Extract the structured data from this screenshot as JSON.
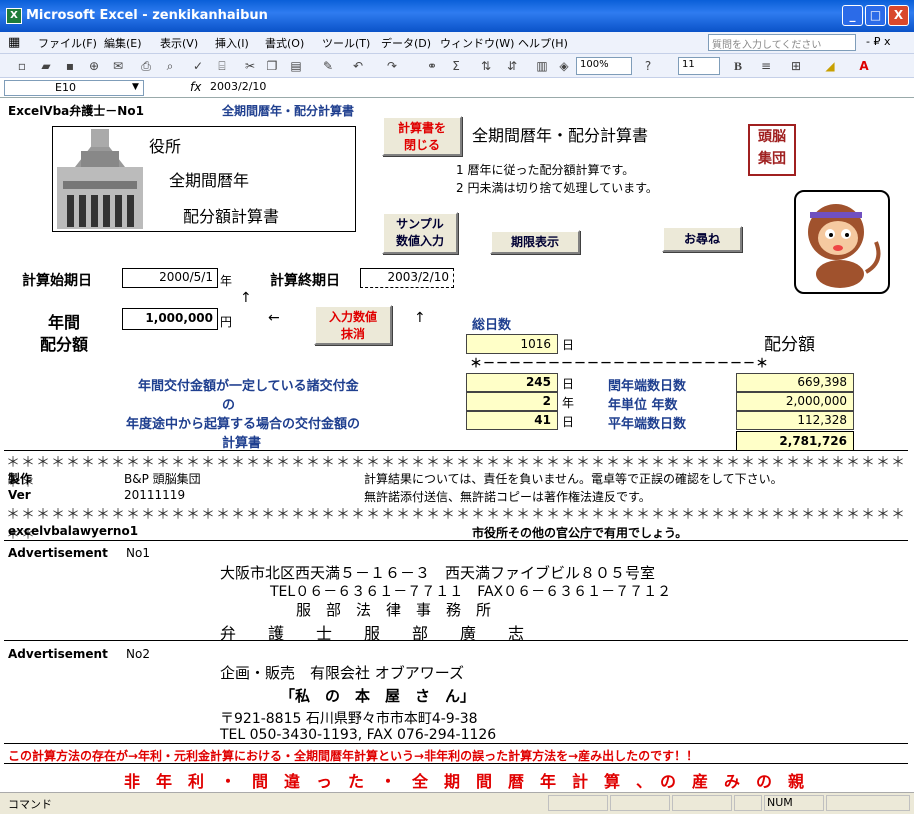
{
  "window": {
    "title": "Microsoft Excel - zenkikanhaibun",
    "min": "_",
    "max": "□",
    "close": "X"
  },
  "menu": {
    "items": [
      "ファイル(F)",
      "編集(E)",
      "表示(V)",
      "挿入(I)",
      "書式(O)",
      "ツール(T)",
      "データ(D)",
      "ウィンドウ(W)",
      "ヘルプ(H)"
    ],
    "help_placeholder": "質問を入力してください",
    "ctrl": "- ₽ x"
  },
  "toolbar": {
    "zoom": "100%",
    "font_size": "11",
    "bold": "B"
  },
  "formula": {
    "cell": "E10",
    "fx": "fx",
    "value": "2003/2/10"
  },
  "sheet": {
    "header_left": "ExcelVba弁護士－No1",
    "header_title": "全期間暦年・配分計算書",
    "building_label": "役所",
    "building_l2": "全期間暦年",
    "building_l3": "配分額計算書",
    "close_btn": "計算書を\n閉じる",
    "main_title": "全期間暦年・配分計算書",
    "logo": "頭脳\n集団",
    "note1": "1 暦年に従った配分額計算です。",
    "note2": "2 円未満は切り捨て処理しています。",
    "sample_btn": "サンプル\n数値入力",
    "term_btn": "期限表示",
    "ask_btn": "お尋ね",
    "start_label": "計算始期日",
    "start_val": "2000/5/1",
    "year_unit": "年",
    "end_label": "計算終期日",
    "end_val": "2003/2/10",
    "annual_label": "年間\n配分額",
    "annual_val": "1,000,000",
    "yen": "円",
    "clear_btn": "入力数値\n抹消",
    "total_days_label": "総日数",
    "total_days": "1016",
    "day": "日",
    "haibun": "配分額",
    "star_line": "＊－－－－－－－－－－－－－－－－－－－－－＊",
    "desc1": "年間交付金額が一定している諸交付金",
    "desc2": "の",
    "desc3": "年度途中から起算する場合の交付金額の",
    "desc4": "計算書",
    "v1": "245",
    "v2": "2",
    "v3": "41",
    "nen": "年",
    "r1_label": "閏年端数日数",
    "r1_val": "669,398",
    "r2_label": "年単位 年数",
    "r2_val": "2,000,000",
    "r3_label": "平年端数日数",
    "r3_val": "112,328",
    "total": "2,781,726",
    "stars": "＊＊＊＊＊＊＊＊＊＊＊＊＊＊＊＊＊＊＊＊＊＊＊＊＊＊＊＊＊＊＊＊＊＊＊＊＊＊＊＊＊＊＊＊＊＊＊＊＊＊＊＊＊＊＊＊＊＊＊＊＊＊",
    "made_label": "製作",
    "made_val": "B&P 頭脳集団",
    "ver_label": "Ver",
    "ver_val": "20111119",
    "disclaim1": "計算結果については、責任を負いません。電卓等で正誤の確認をして下さい。",
    "disclaim2": "無許諾添付送信、無許諾コピーは著作権法違反です。",
    "footer_id": "excelvbalawyerno1",
    "footer_note": "市役所その他の官公庁で有用でしょう。",
    "ad1_label": "Advertisement",
    "ad1_no": "No1",
    "ad1_l1": "大阪市北区西天満５－１６－３　西天満ファイブビル８０５号室",
    "ad1_l2": "TEL０６－６３６１－７７１１　FAX０６－６３６１－７７１２",
    "ad1_l3": "服　部　法　律　事　務　所",
    "ad1_l4": "弁　　護　　士　　服　　部　　廣　　志",
    "ad2_label": "Advertisement",
    "ad2_no": "No2",
    "ad2_l1": "企画・販売　有限会社 オブアワーズ",
    "ad2_l2": "「私　の　本　屋　さ　ん」",
    "ad2_l3": "〒921-8815 石川県野々市市本町4-9-38",
    "ad2_l4": "TEL 050-3430-1193, FAX 076-294-1126",
    "warn1": "この計算方法の存在が→年利・元利金計算における・全期間暦年計算という→非年利の誤った計算方法を→産み出したのです！！",
    "warn2": "非　年　利　・　間　違　っ　た　・　全　期　間　暦　年　計　算　、　の　産　み　の　親"
  },
  "status": {
    "left": "コマンド",
    "num": "NUM"
  }
}
